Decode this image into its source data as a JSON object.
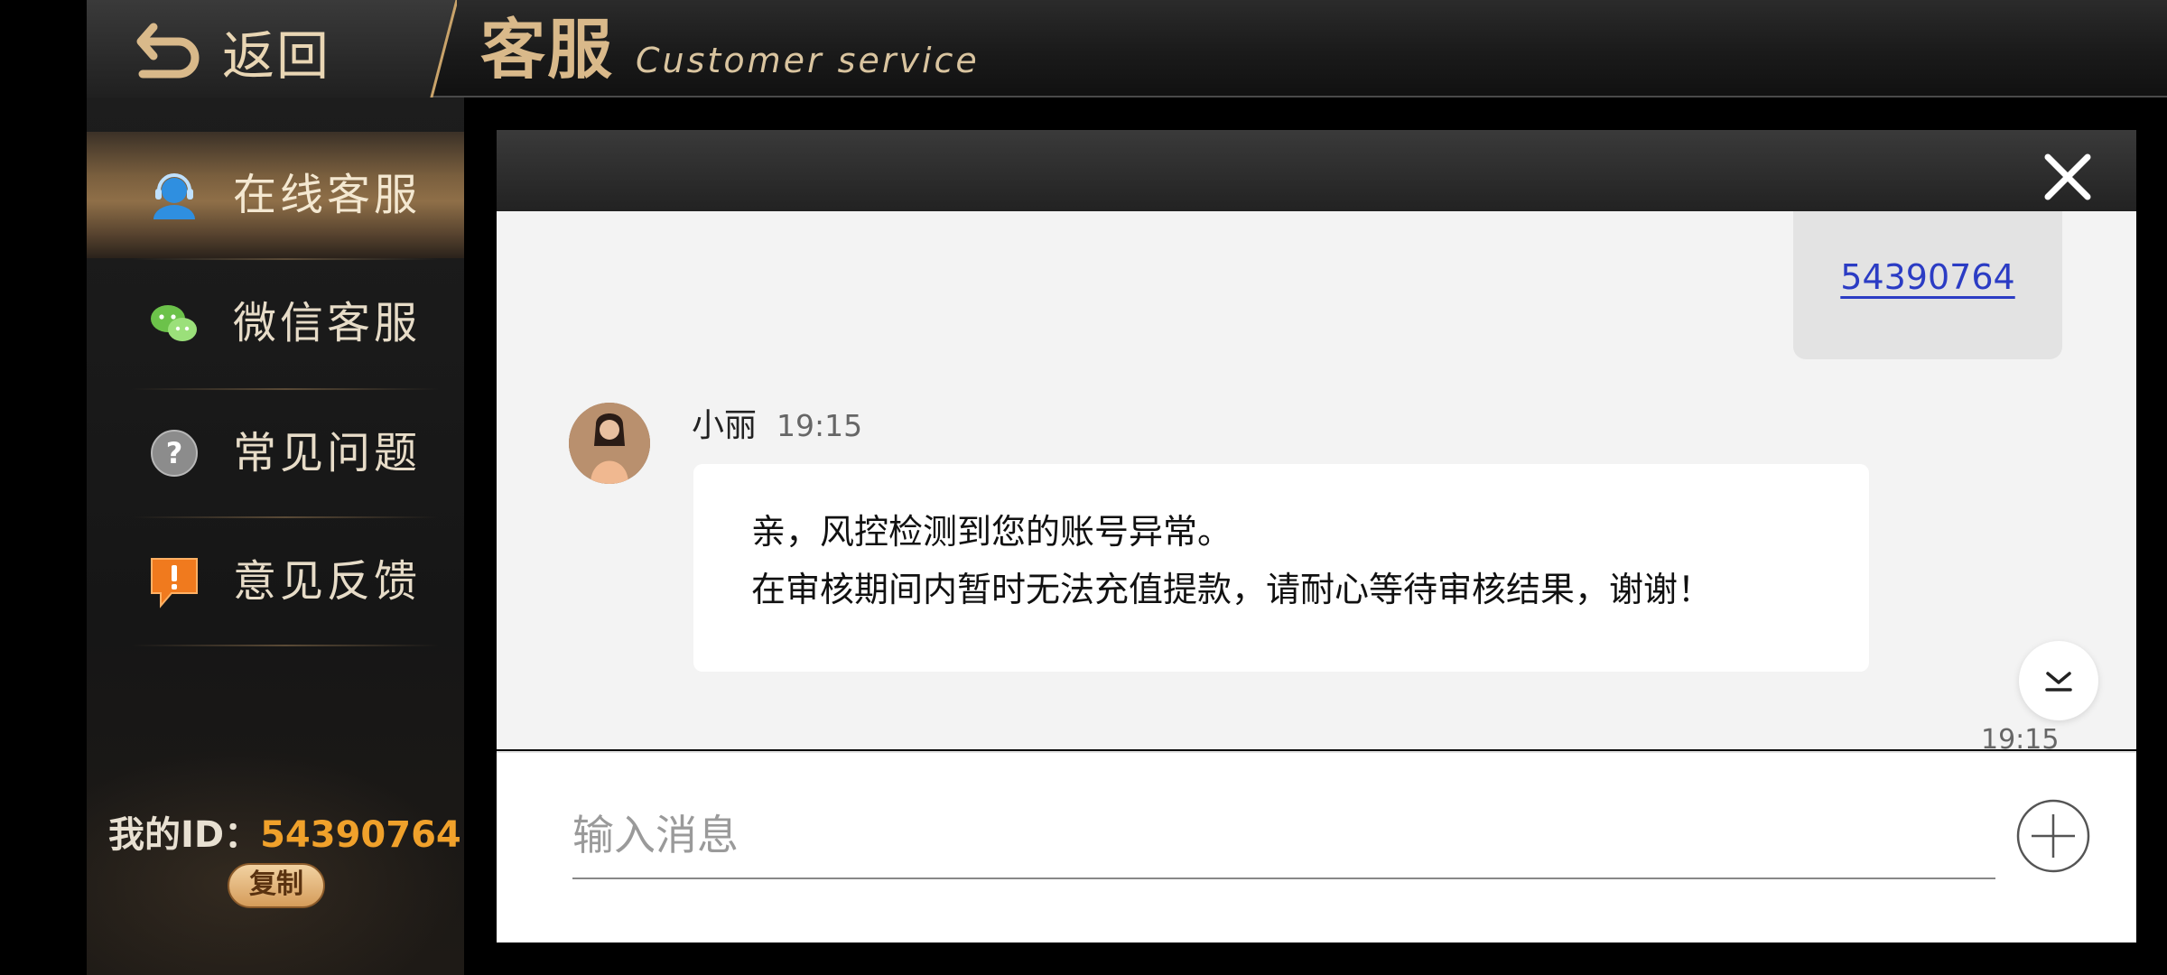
{
  "header": {
    "back_label": "返回",
    "title_cn": "客服",
    "title_en": "Customer service"
  },
  "sidebar": {
    "items": [
      {
        "label": "在线客服",
        "icon": "headset-user-icon",
        "active": true
      },
      {
        "label": "微信客服",
        "icon": "wechat-icon",
        "active": false
      },
      {
        "label": "常见问题",
        "icon": "question-icon",
        "active": false
      },
      {
        "label": "意见反馈",
        "icon": "feedback-icon",
        "active": false
      }
    ],
    "my_id_label": "我的ID：",
    "my_id_value": "54390764",
    "copy_label": "复制"
  },
  "chat": {
    "my_message": "54390764",
    "agent_name": "小丽",
    "agent_time": "19:15",
    "agent_message_line1": "亲，风控检测到您的账号异常。",
    "agent_message_line2": "在审核期间内暂时无法充值提款，请耐心等待审核结果，谢谢！",
    "bottom_time": "19:15",
    "input_placeholder": "输入消息"
  },
  "colors": {
    "accent_gold": "#d9b98a",
    "id_orange": "#f0a12b",
    "link_blue": "#2b3cc4"
  }
}
